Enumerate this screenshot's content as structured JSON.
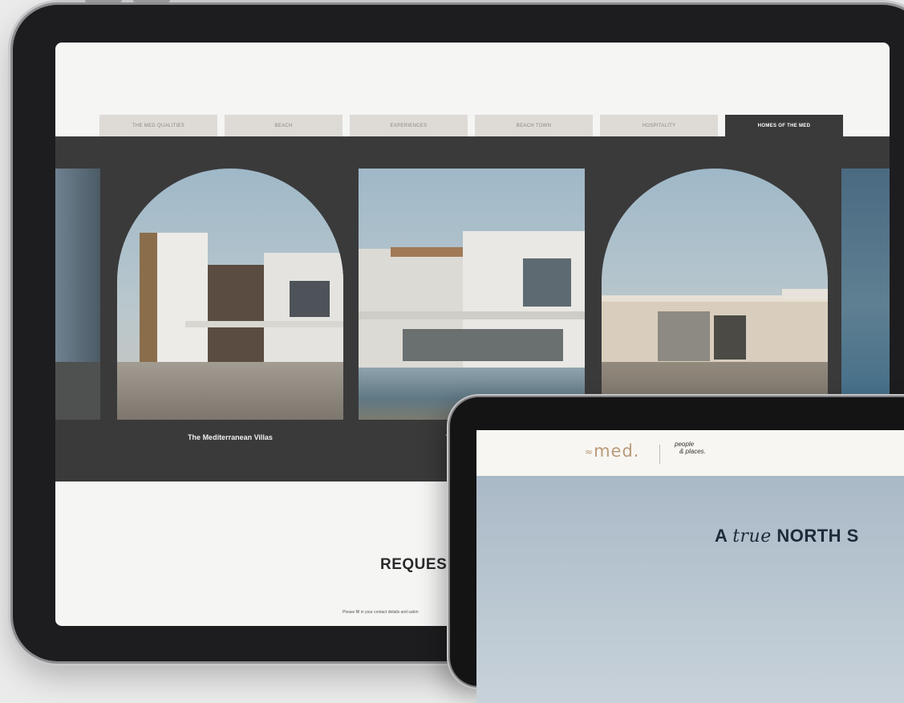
{
  "back_site": {
    "tabs": [
      {
        "label": "THE MED QUALITIES",
        "active": false
      },
      {
        "label": "BEACH",
        "active": false
      },
      {
        "label": "EXPERIENCES",
        "active": false
      },
      {
        "label": "BEACH TOWN",
        "active": false
      },
      {
        "label": "HOSPITALITY",
        "active": false
      },
      {
        "label": "HOMES OF THE MED",
        "active": true
      }
    ],
    "carousel": [
      {
        "caption": "The Mediterranean Villas",
        "shape": "arch"
      },
      {
        "caption": "The Mediterran",
        "shape": "square"
      },
      {
        "caption": "",
        "shape": "arch"
      }
    ],
    "cta": {
      "title": "REQUEST",
      "subtitle": "Please fill in your contact details and subm"
    }
  },
  "front_site": {
    "logo": "med.",
    "tagline_line1": "people",
    "tagline_line2": "& places.",
    "hero": {
      "title_pre": "A ",
      "title_em": "true",
      "title_post": " NORTH S"
    }
  },
  "colors": {
    "dark_band": "#3a3a3b",
    "tab_bg": "#dedbd7",
    "accent_logo": "#b99a7a"
  }
}
